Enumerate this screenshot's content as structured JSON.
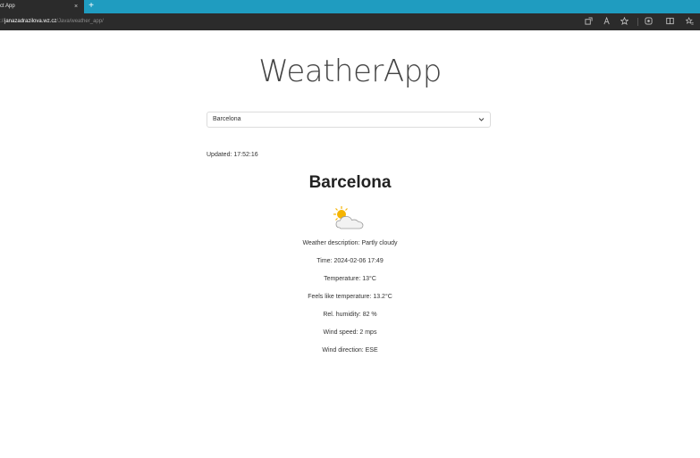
{
  "browser": {
    "tab_title": "ct App",
    "tab_close": "×",
    "new_tab": "+",
    "url_prefix": "://",
    "url_host": "janazadrazilova.wz.cz",
    "url_path": "/Java/weather_app/"
  },
  "app": {
    "title": "WeatherApp",
    "selected_city": "Barcelona",
    "updated": "Updated: 17:52:16",
    "city_heading": "Barcelona",
    "weather_icon": "partly-cloudy-icon",
    "details": [
      "Weather description: Partly cloudy",
      "Time: 2024-02-06 17:49",
      "Temperature: 13°C",
      "Feels like temperature: 13.2°C",
      "Rel. humidity: 82 %",
      "Wind speed: 2 mps",
      "Wind direction: ESE"
    ]
  },
  "colors": {
    "tabbar": "#1f9cc0",
    "toolbar": "#2b2b2b",
    "sun": "#f5b400",
    "cloud": "#f2f2f2"
  }
}
